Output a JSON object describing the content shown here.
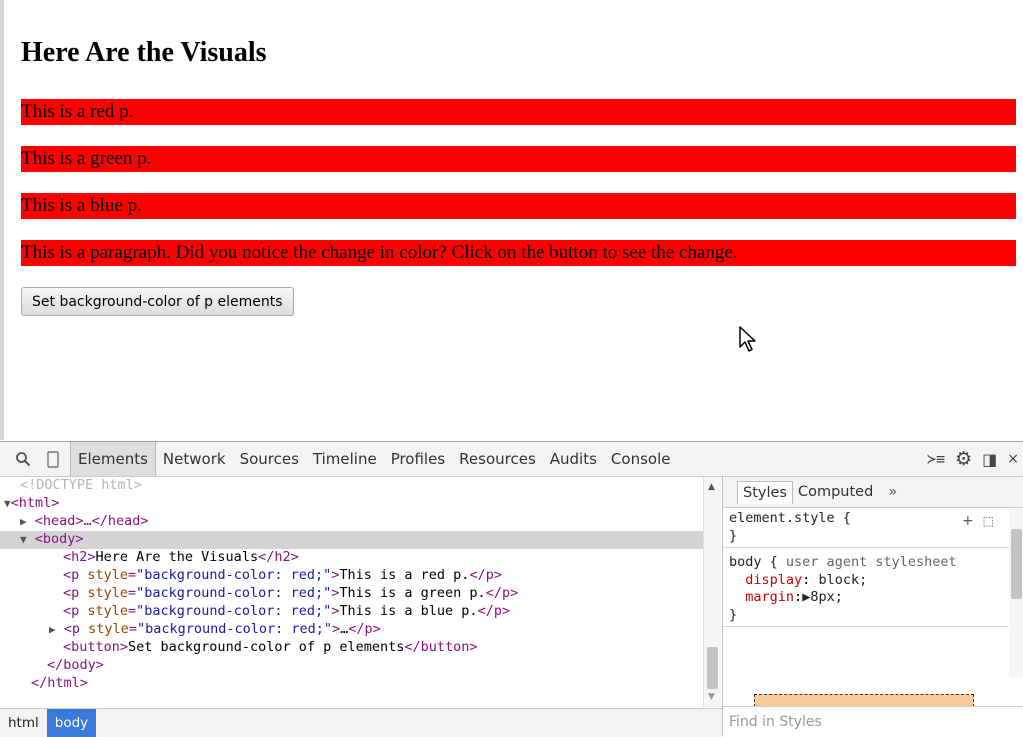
{
  "page": {
    "heading": "Here Are the Visuals",
    "paragraphs": [
      "This is a red p.",
      "This is a green p.",
      "This is a blue p.",
      "This is a paragraph. Did you notice the change in color? Click on the button to see the change."
    ],
    "button_label": "Set background-color of p elements",
    "paragraph_bg": "#ff0000"
  },
  "devtools": {
    "tabs": [
      "Elements",
      "Network",
      "Sources",
      "Timeline",
      "Profiles",
      "Resources",
      "Audits",
      "Console"
    ],
    "active_tab": "Elements",
    "dom": {
      "doctype": "<!DOCTYPE html>",
      "html_open": "<html>",
      "head": "<head>…</head>",
      "body_open": "<body>",
      "h2_open": "<h2>",
      "h2_text": "Here Are the Visuals",
      "h2_close": "</h2>",
      "p_open": "<p ",
      "p_attr": "style",
      "p_style_value": "\"background-color: red;\"",
      "p_close_bracket": ">",
      "p_texts": [
        "This is a red p.",
        "This is a green p.",
        "This is a blue p."
      ],
      "p_collapsed": "…",
      "p_end": "</p>",
      "button_open": "<button>",
      "button_text": "Set background-color of p elements",
      "button_close": "</button>",
      "body_close": "</body>",
      "html_close": "</html>"
    },
    "breadcrumbs": [
      "html",
      "body"
    ],
    "styles": {
      "tabs": [
        "Styles",
        "Computed"
      ],
      "more": "»",
      "element_style": "element.style {",
      "close_brace": "}",
      "body_selector": "body {",
      "ua_label": "user agent stylesheet",
      "display_prop": "display",
      "display_val": "block;",
      "margin_prop": "margin",
      "margin_val": "▶8px;",
      "find_placeholder": "Find in Styles"
    }
  }
}
